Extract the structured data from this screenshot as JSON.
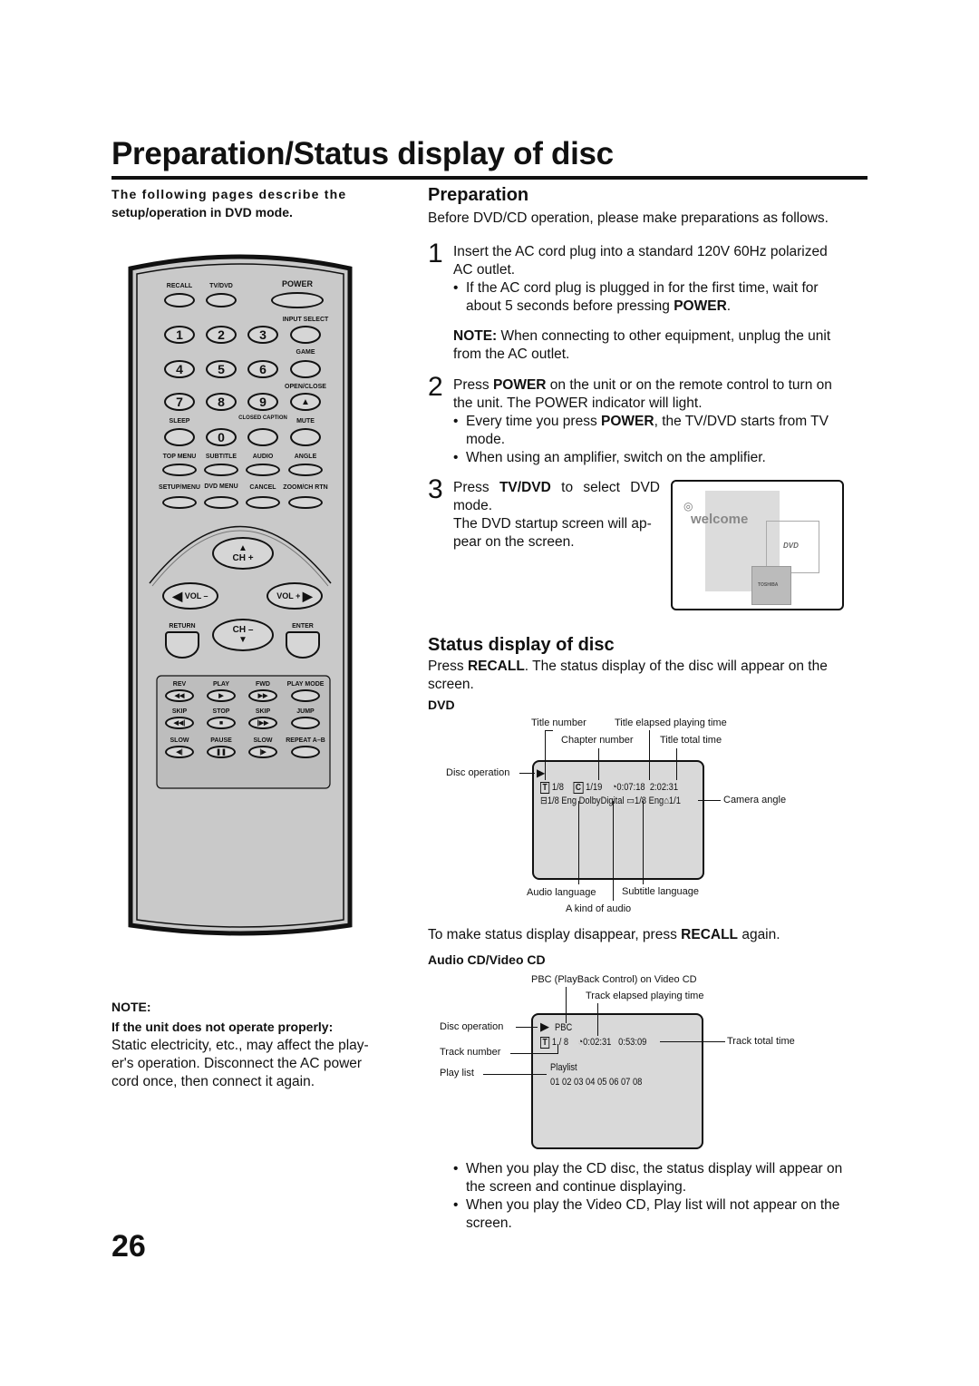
{
  "page": {
    "title": "Preparation/Status display of disc",
    "page_number": "26"
  },
  "left": {
    "intro": [
      "The following pages describe the",
      "setup/operation in DVD mode."
    ],
    "note_heading": "NOTE:",
    "note_subheading": "If the unit does not operate properly:",
    "note_text": "Static electricity, etc., may affect the play-er's operation. Disconnect the AC power cord once, then connect it again."
  },
  "remote": {
    "labels": [
      "RECALL",
      "TV/DVD",
      "POWER",
      "INPUT SELECT",
      "GAME",
      "OPEN/CLOSE",
      "SLEEP",
      "CLOSED CAPTION",
      "MUTE",
      "TOP MENU",
      "SUBTITLE",
      "AUDIO",
      "ANGLE",
      "SETUP/MENU",
      "DVD MENU",
      "CANCEL",
      "ZOOM/CH RTN",
      "RETURN",
      "ENTER",
      "REV",
      "PLAY",
      "FWD",
      "PLAY MODE",
      "SKIP",
      "STOP",
      "SKIP",
      "JUMP",
      "SLOW",
      "PAUSE",
      "SLOW",
      "REPEAT A–B"
    ],
    "digits": [
      "1",
      "2",
      "3",
      "4",
      "5",
      "6",
      "7",
      "8",
      "9",
      "0"
    ],
    "ch_up": "CH +",
    "ch_down": "CH –",
    "vol_down": "VOL –",
    "vol_up": "VOL +",
    "transport_glyphs": [
      "◀◀",
      "▶",
      "▶▶",
      "",
      "◀◀|",
      "■",
      "|▶▶",
      "",
      "◀|",
      "❚❚",
      "|▶",
      ""
    ]
  },
  "preparation": {
    "heading": "Preparation",
    "lead": "Before DVD/CD operation, please make preparations as follows.",
    "step1_num": "1",
    "step1": "Insert the AC cord plug into a standard 120V 60Hz polarized AC outlet.",
    "step1_bullet_pre": "If the AC cord plug is plugged in for the first time, wait for about 5 seconds before pressing ",
    "step1_bullet_bold": "POWER",
    "step1_bullet_post": ".",
    "note_bold": "NOTE:",
    "note_text": " When connecting to other equipment, unplug the unit from the AC outlet.",
    "step2_num": "2",
    "step2_pre": "Press ",
    "step2_bold": "POWER",
    "step2_post": " on the unit or on the remote control to turn on the unit. The POWER indicator will light.",
    "step2_b1_pre": "Every time you press ",
    "step2_b1_bold": "POWER",
    "step2_b1_post": ", the TV/DVD starts from TV mode.",
    "step2_b2": "When using an amplifier, switch on the amplifier.",
    "step3_num": "3",
    "step3_pre": "Press ",
    "step3_bold": "TV/DVD",
    "step3_post": " to select DVD mode.",
    "step3_text2": "The DVD startup screen will ap-pear on the screen.",
    "welcome_screen": {
      "welcome": "welcome",
      "dvd_logo": "DVD",
      "brand": "TOSHIBA"
    }
  },
  "status": {
    "heading": "Status display of disc",
    "lead_pre": "Press ",
    "lead_bold": "RECALL",
    "lead_post": ". The status display of the disc will appear on the screen.",
    "dvd_heading": "DVD",
    "dvd": {
      "title_number": "Title number",
      "chapter_number": "Chapter number",
      "title_elapsed": "Title elapsed playing time",
      "title_total": "Title total time",
      "disc_operation": "Disc operation",
      "camera_angle": "Camera angle",
      "audio_language": "Audio language",
      "kind_of_audio": "A kind of audio",
      "subtitle_language": "Subtitle language",
      "osd": {
        "t_icon": "T",
        "title": "1/8",
        "c_icon": "C",
        "chapter": "1/19",
        "elapsed": "0:07:18",
        "total": "2:02:31",
        "audio": "1/8 Eng DolbyDigital",
        "subtitle": "1/8 Eng",
        "angle": "1/1"
      }
    },
    "disappear_pre": "To make status display disappear, press ",
    "disappear_bold": "RECALL",
    "disappear_post": " again.",
    "cd_heading": "Audio CD/Video CD",
    "cd": {
      "pbc_label": "PBC (PlayBack Control) on Video CD",
      "track_elapsed": "Track elapsed playing time",
      "disc_operation": "Disc operation",
      "track_total": "Track total time",
      "track_number": "Track number",
      "play_list": "Play list",
      "osd": {
        "pbc": "PBC",
        "t_icon": "T",
        "track": "1 / 8",
        "elapsed": "0:02:31",
        "total": "0:53:09",
        "playlist": "Playlist",
        "tracks": "01  02  03  04  05  06  07  08"
      }
    },
    "bullets": [
      "When you play the CD disc, the status display will appear on the screen and continue displaying.",
      "When you play the Video CD, Play list will not appear on the screen."
    ]
  }
}
